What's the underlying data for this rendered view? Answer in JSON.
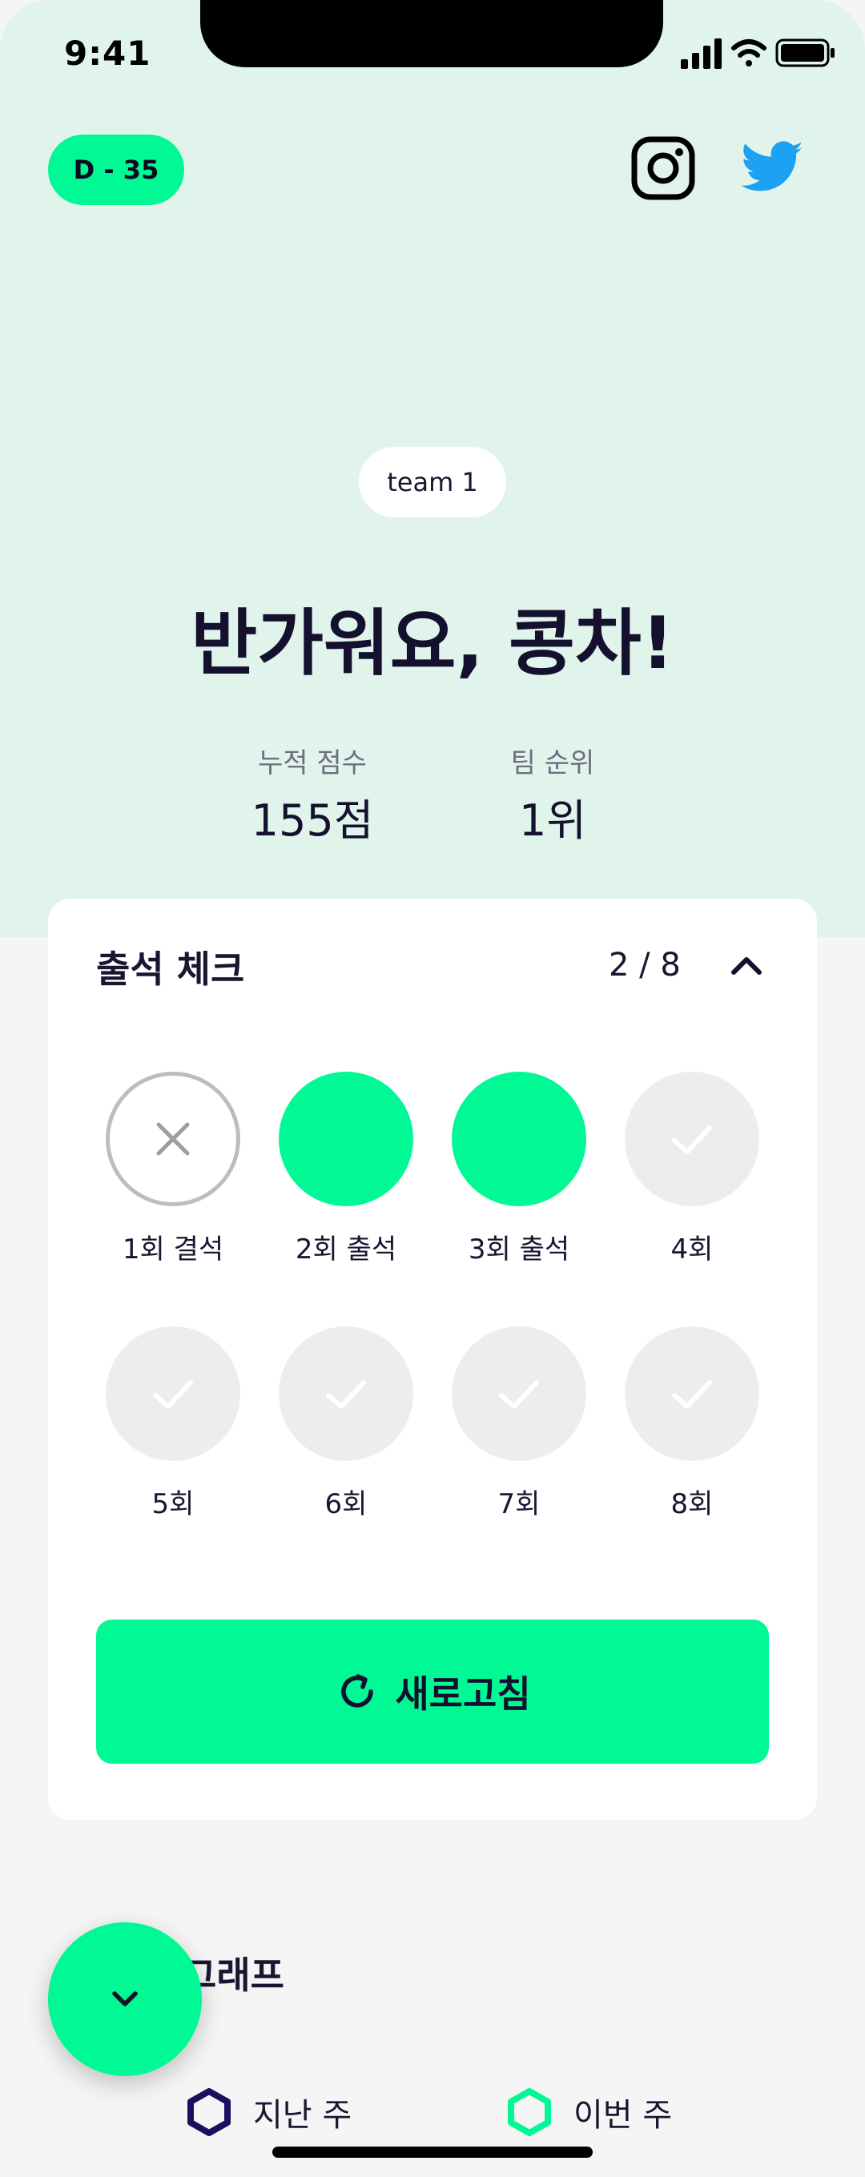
{
  "status_bar": {
    "time": "9:41"
  },
  "header": {
    "dday": "D - 35",
    "social_icons": [
      "instagram-icon",
      "twitter-icon"
    ]
  },
  "hero": {
    "team": "team 1",
    "greeting": "반가워요, 콩차!",
    "stats": {
      "score_label": "누적 점수",
      "score_value": "155점",
      "rank_label": "팀 순위",
      "rank_value": "1위"
    }
  },
  "attendance": {
    "title": "출석 체크",
    "count": "2 / 8",
    "sessions": [
      {
        "label": "1회 결석",
        "status": "absent"
      },
      {
        "label": "2회 출석",
        "status": "present"
      },
      {
        "label": "3회 출석",
        "status": "present"
      },
      {
        "label": "4회",
        "status": "pending"
      },
      {
        "label": "5회",
        "status": "pending"
      },
      {
        "label": "6회",
        "status": "pending"
      },
      {
        "label": "7회",
        "status": "pending"
      },
      {
        "label": "8회",
        "status": "pending"
      }
    ],
    "refresh_label": "새로고침"
  },
  "graph": {
    "title": "그래프",
    "legend": {
      "last_week": "지난 주",
      "this_week": "이번 주"
    }
  },
  "colors": {
    "accent": "#00F994",
    "hero_bg": "#E0F4EC",
    "dark_text": "#14102E",
    "last_week": "#1A1060",
    "this_week": "#00F994",
    "twitter": "#1DA1F2"
  }
}
